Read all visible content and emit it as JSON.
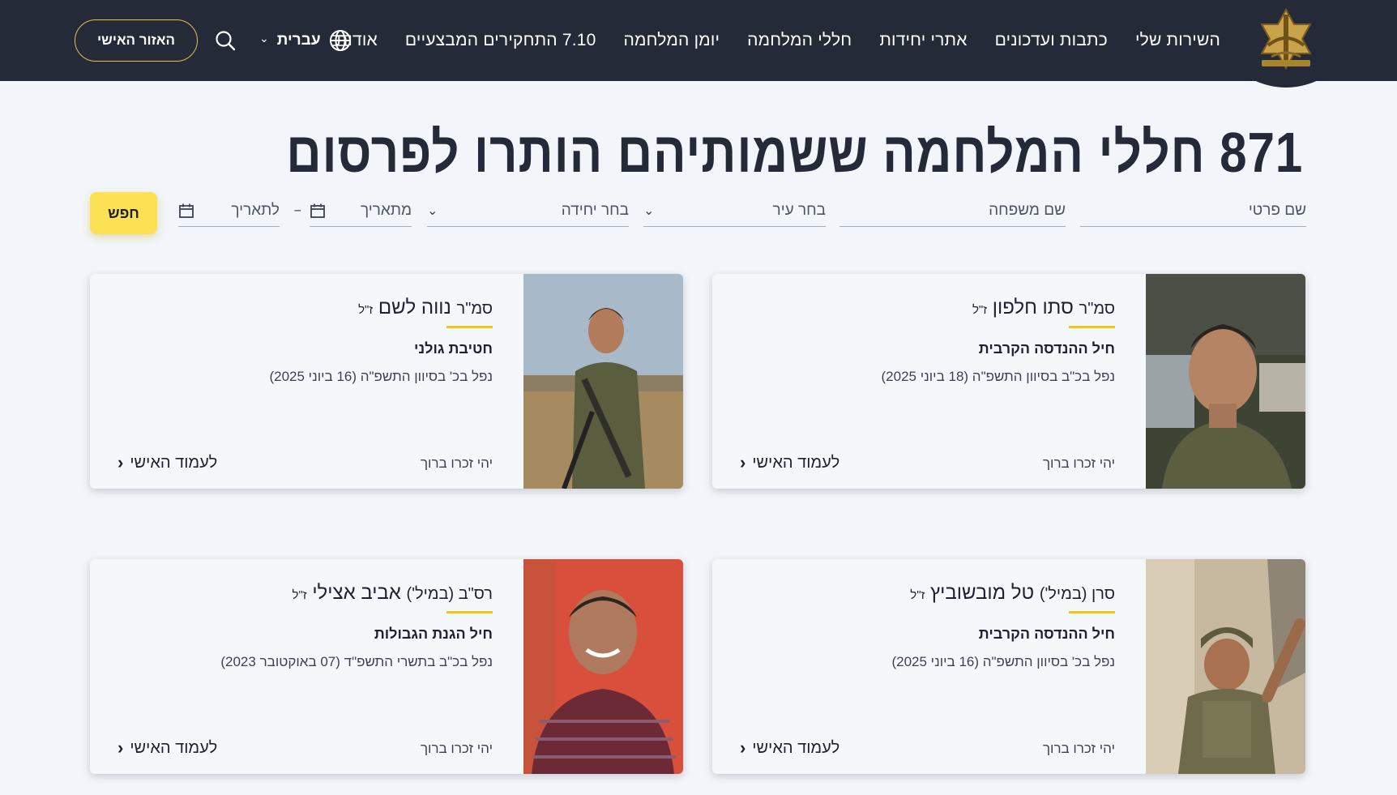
{
  "nav": {
    "items": [
      "השירות שלי",
      "כתבות ועדכונים",
      "אתרי יחידות",
      "חללי המלחמה",
      "יומן המלחמה",
      "7.10 התחקירים המבצעיים",
      "אודות"
    ],
    "language": "עברית",
    "personal_area": "האזור האישי",
    "logo_icon": "idf-emblem-icon",
    "search_icon": "search-icon",
    "globe_icon": "globe-icon"
  },
  "page_title": "871 חללי המלחמה ששמותיהם הותרו לפרסום",
  "filters": {
    "first_name": "שם פרטי",
    "last_name": "שם משפחה",
    "city": "בחר עיר",
    "unit": "בחר יחידה",
    "from_date": "מתאריך",
    "to_date": "לתאריך",
    "date_separator": "–",
    "search_button": "חפש",
    "calendar_icon": "calendar-icon",
    "dropdown_icon": "chevron-down-icon"
  },
  "colors": {
    "header_bg": "#252a38",
    "accent_yellow": "#fde155",
    "underline_yellow": "#f1c615",
    "page_bg": "#f2f6fa"
  },
  "cards": [
    {
      "rank": "סמ\"ר",
      "name": "סתו חלפון",
      "suffix": "ז\"ל",
      "unit": "חיל ההנדסה הקרבית",
      "fell": "נפל בכ\"ב בסיוון התשפ\"ה (18 ביוני 2025)",
      "memorial": "יהי זכרו ברוך",
      "link": "לעמוד האישי"
    },
    {
      "rank": "סמ\"ר",
      "name": "נווה לשם",
      "suffix": "ז\"ל",
      "unit": "חטיבת גולני",
      "fell": "נפל בכ' בסיוון התשפ\"ה (16 ביוני 2025)",
      "memorial": "יהי זכרו ברוך",
      "link": "לעמוד האישי"
    },
    {
      "rank": "סרן (במיל')",
      "name": "טל מובשוביץ",
      "suffix": "ז\"ל",
      "unit": "חיל ההנדסה הקרבית",
      "fell": "נפל בכ' בסיוון התשפ\"ה (16 ביוני 2025)",
      "memorial": "יהי זכרו ברוך",
      "link": "לעמוד האישי"
    },
    {
      "rank": "רס\"ב (במיל')",
      "name": "אביב אצילי",
      "suffix": "ז\"ל",
      "unit": "חיל הגנת הגבולות",
      "fell": "נפל בכ\"ב בתשרי התשפ\"ד (07 באוקטובר 2023)",
      "memorial": "יהי זכרו ברוך",
      "link": "לעמוד האישי"
    }
  ]
}
